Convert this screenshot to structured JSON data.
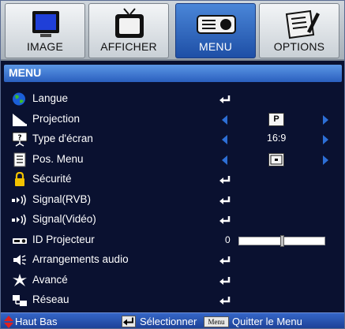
{
  "tabs": [
    {
      "label": "IMAGE",
      "icon": "monitor-icon",
      "active": false
    },
    {
      "label": "AFFICHER",
      "icon": "tv-icon",
      "active": false
    },
    {
      "label": "MENU",
      "icon": "projector-icon",
      "active": true
    },
    {
      "label": "OPTIONS",
      "icon": "notepad-pencil-icon",
      "active": false
    }
  ],
  "header": {
    "title": "MENU"
  },
  "items": [
    {
      "label": "Langue",
      "icon": "globe-icon"
    },
    {
      "label": "Projection",
      "icon": "projection-icon",
      "value": "P"
    },
    {
      "label": "Type d'écran",
      "icon": "screen-type-icon",
      "value": "16:9"
    },
    {
      "label": "Pos. Menu",
      "icon": "menu-position-icon"
    },
    {
      "label": "Sécurité",
      "icon": "lock-icon"
    },
    {
      "label": "Signal(RVB)",
      "icon": "signal-icon"
    },
    {
      "label": "Signal(Vidéo)",
      "icon": "signal-icon"
    },
    {
      "label": "ID Projecteur",
      "icon": "projector-id-icon",
      "value": "0",
      "slider": 0.5
    },
    {
      "label": "Arrangements audio",
      "icon": "speaker-icon"
    },
    {
      "label": "Avancé",
      "icon": "star-burst-icon"
    },
    {
      "label": "Réseau",
      "icon": "network-icon"
    }
  ],
  "footer": {
    "nav": "Haut Bas",
    "select": "Sélectionner",
    "menu_key": "Menu",
    "quit": "Quitter le Menu"
  },
  "colors": {
    "accent": "#2d6fd6",
    "background": "#0a1130",
    "header": "#3c79d8",
    "footer": "#2852ad"
  }
}
